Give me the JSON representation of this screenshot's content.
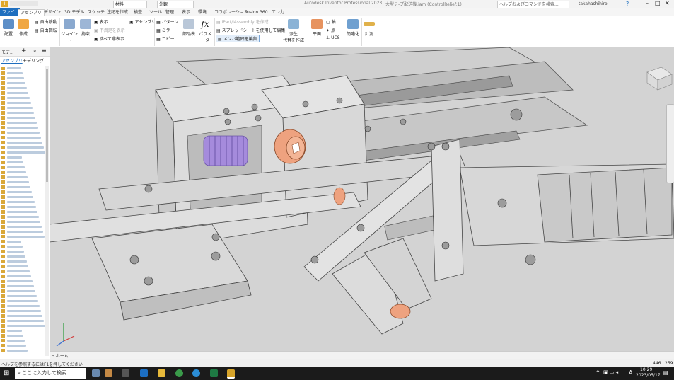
{
  "titlebar": {
    "product": "Autodesk Inventor Professional 2023",
    "document": "大型テ-プ配送機.iam (ControlRelief:1)",
    "search_placeholder": "ヘルプおよびコマンドを検索...",
    "user": "takahashihiro",
    "material": "材料",
    "appearance": "外観"
  },
  "tabs": [
    "ファイル",
    "アセンブリ",
    "デザイン",
    "3D モデル",
    "スケッチ",
    "注記を作成",
    "検査",
    "ツール",
    "管理",
    "表示",
    "環境",
    "コラボレーション",
    "Fusion 360",
    "エレ力"
  ],
  "ribbon": {
    "place": "配置",
    "create": "作成",
    "free_move": "自由移動",
    "free_rotate": "自由回転",
    "joint": "ジョイント",
    "constraint": "拘束",
    "show": "表示",
    "show_unsatisfied": "不満足を表示",
    "show_all_deg": "すべて非表示",
    "assemble": "アセンブリ",
    "pattern": "パターン",
    "mirror": "ミラー",
    "copy": "コピー",
    "parts_list": "部品表",
    "parameters": "パラメータ",
    "create_ipart": "iPart/iAssembly を作成",
    "edit_spreadsheet": "スプレッドシートを使用して編集",
    "edit_member_scope": "メンバ範囲を編集",
    "derive": "派生",
    "derive_sub": "代替を作成",
    "plane": "平面",
    "axis": "軸",
    "point": "点",
    "ucs": "UCS",
    "simplify": "簡略化",
    "measure": "計測"
  },
  "browser": {
    "title": "モデ..",
    "tab_assembly": "アセンブリ",
    "tab_modeling": "モデリング"
  },
  "doc_tab": "ホーム",
  "status": {
    "help": "ヘルプを参照するにはF1を押してください",
    "count1": "446",
    "count2": "259"
  },
  "taskbar": {
    "search": "ここに入力して検索",
    "time": "10:29",
    "date": "2023/05/17",
    "ime": "A"
  },
  "colors": {
    "accent": "#1f6fbf",
    "spring": "#a58bdc",
    "bushing": "#e89a7c",
    "part_gray": "#d9d9d9"
  }
}
